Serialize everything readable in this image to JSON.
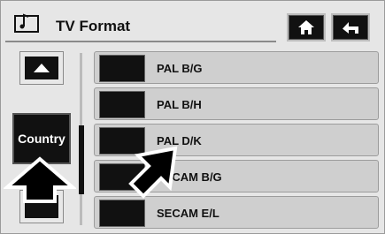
{
  "header": {
    "title": "TV Format"
  },
  "sidebar": {
    "country_label": "Country"
  },
  "list": {
    "items": [
      {
        "label": "PAL B/G"
      },
      {
        "label": "PAL B/H"
      },
      {
        "label": "PAL D/K"
      },
      {
        "label": "SECAM B/G"
      },
      {
        "label": "SECAM E/L"
      }
    ]
  },
  "icons": {
    "title": "music-note-screen-icon",
    "home": "home-icon",
    "back": "back-arrow-icon",
    "scroll_up": "triangle-up-icon",
    "scroll_down": "triangle-down-icon",
    "gesture_up": "gesture-arrow-up-icon",
    "gesture_diag": "gesture-arrow-diagonal-icon"
  },
  "colors": {
    "background": "#e6e6e6",
    "row": "#cfcfcf",
    "button": "#111111"
  }
}
